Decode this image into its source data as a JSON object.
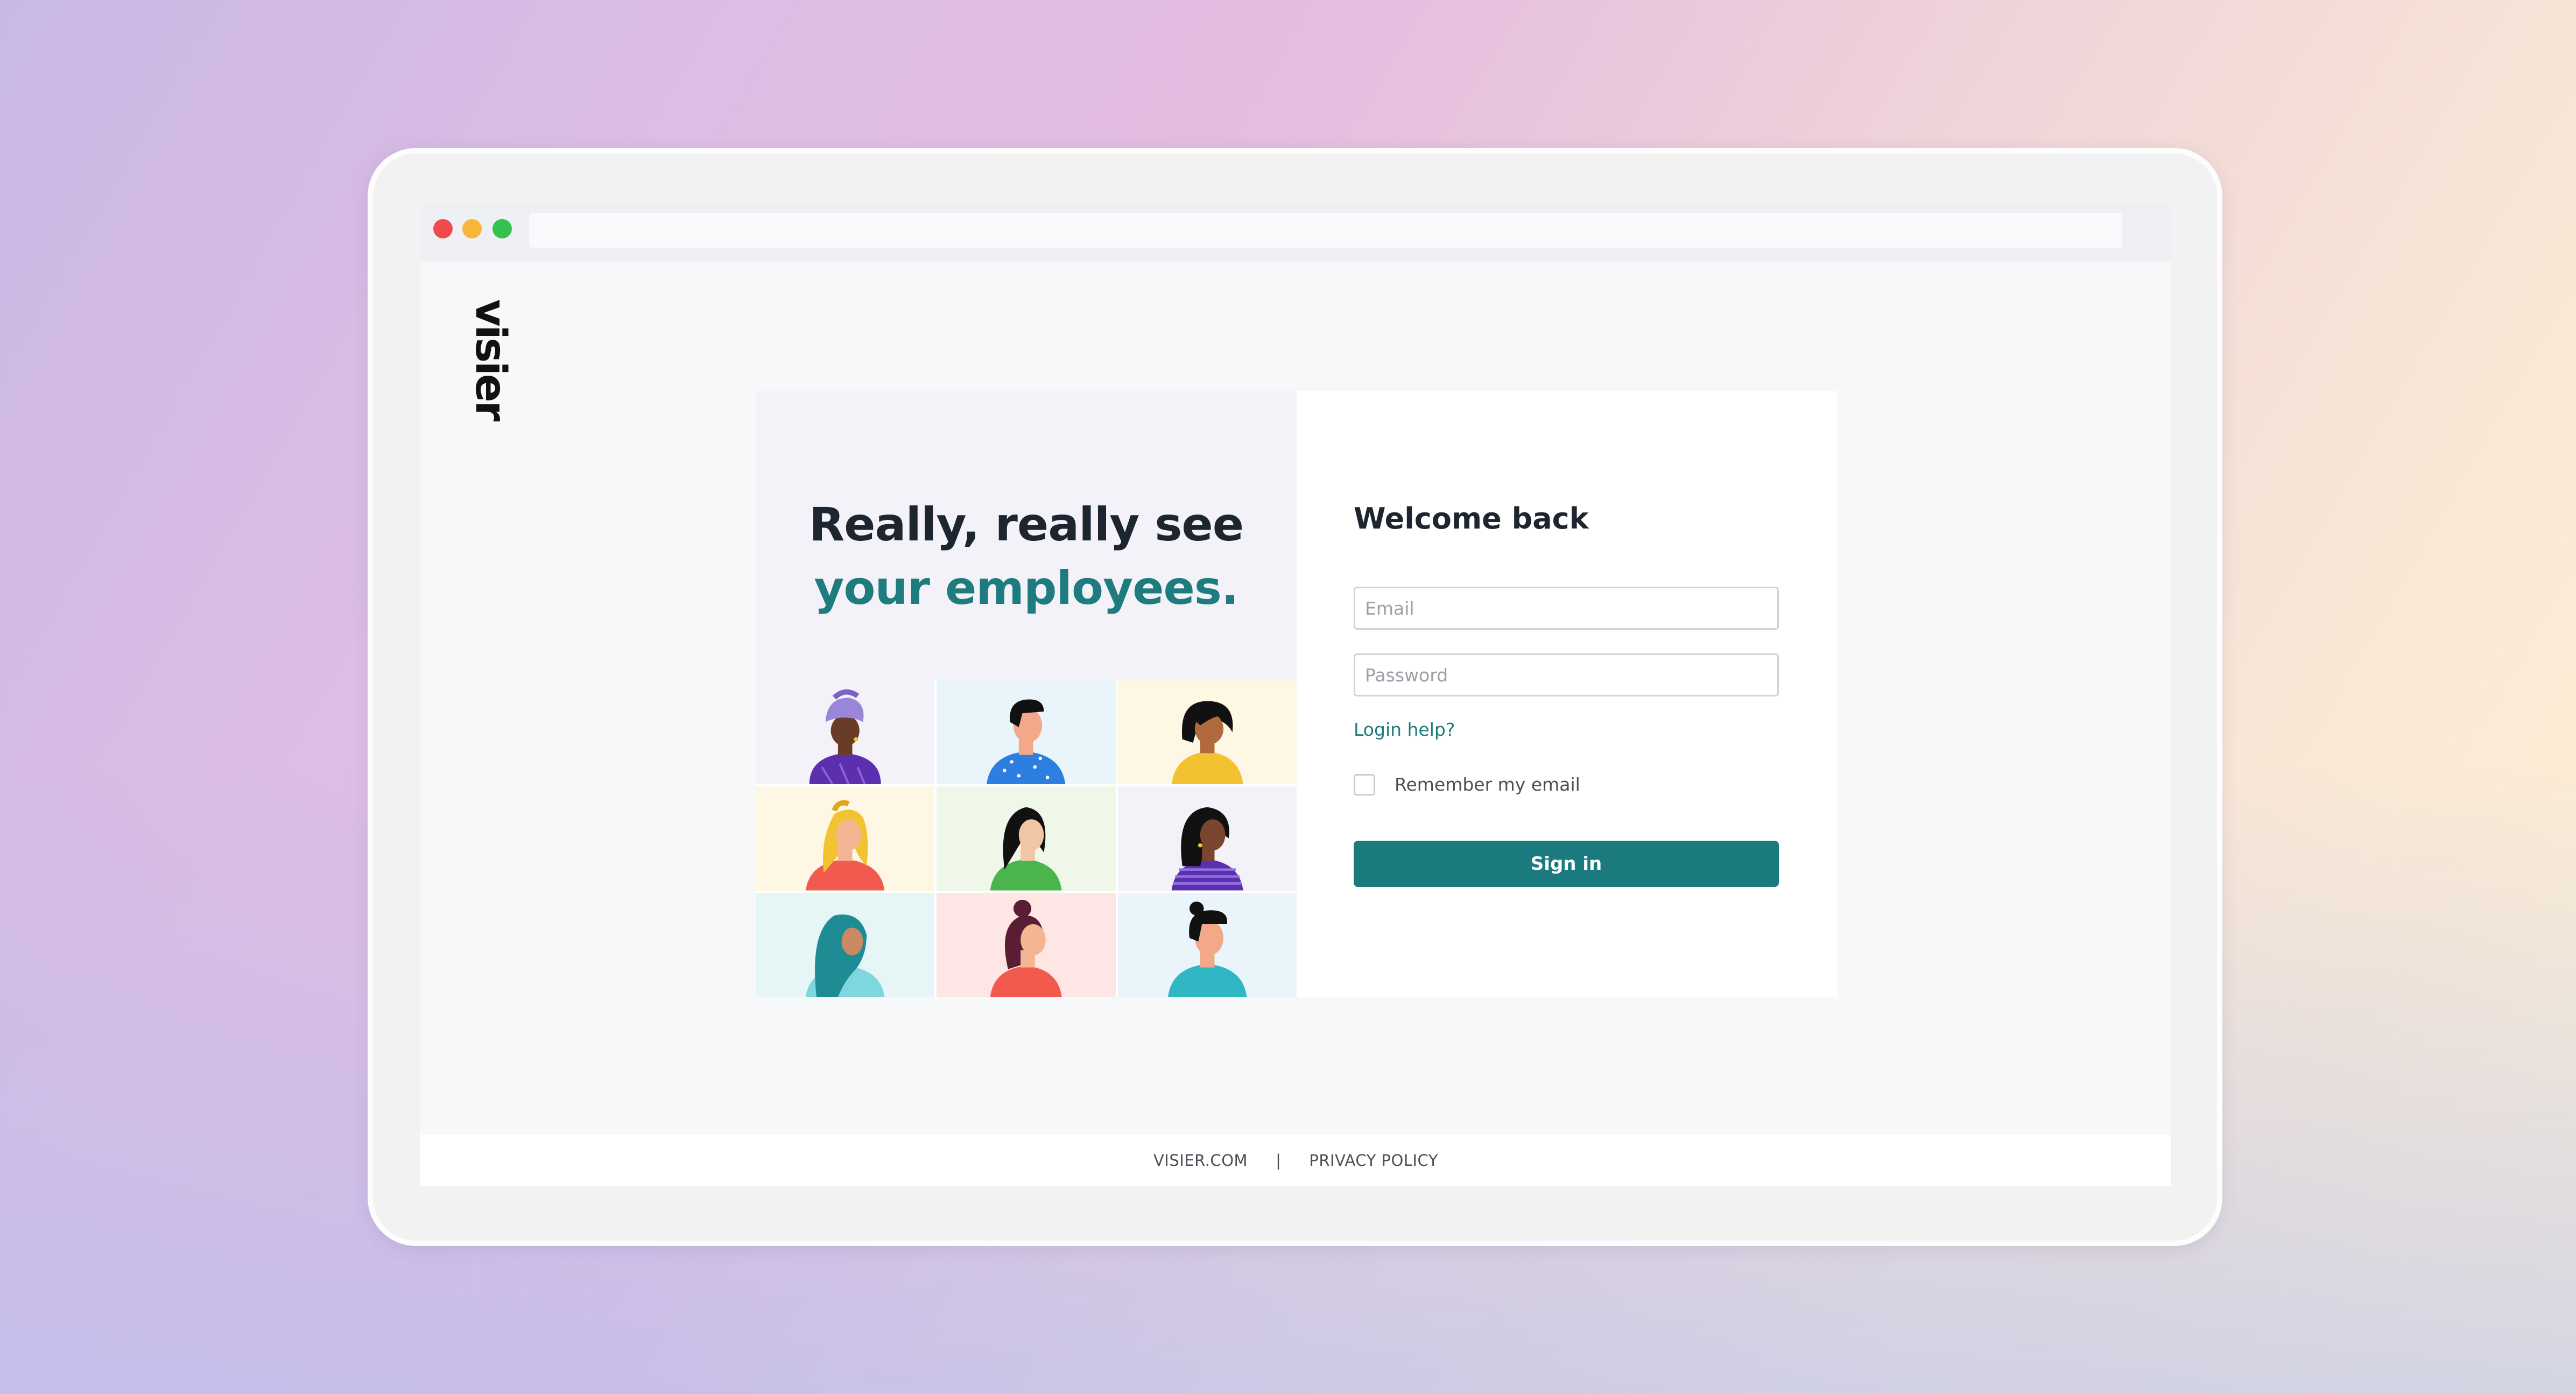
{
  "window": {
    "controls": [
      {
        "name": "close",
        "color": "#ef4b4a"
      },
      {
        "name": "minimize",
        "color": "#f6b739"
      },
      {
        "name": "maximize",
        "color": "#33c24d"
      }
    ],
    "address": ""
  },
  "brand": {
    "logo_text": "visier"
  },
  "hero": {
    "headline_line1": "Really, really see",
    "headline_line2": "your employees.",
    "accent_color": "#1e7b7e",
    "illustrations": [
      "person-purple-headwrap-icon",
      "person-blue-shirt-icon",
      "person-yellow-top-icon",
      "person-blonde-red-top-icon",
      "person-green-top-icon",
      "person-purple-striped-icon",
      "person-teal-hijab-icon",
      "person-red-top-bun-icon",
      "person-teal-shirt-icon"
    ]
  },
  "login": {
    "title": "Welcome back",
    "email_placeholder": "Email",
    "email_value": "",
    "password_placeholder": "Password",
    "password_value": "",
    "login_help": "Login help?",
    "remember_label": "Remember my email",
    "remember_checked": false,
    "sign_in": "Sign in",
    "button_color": "#1b7a7d"
  },
  "footer": {
    "site_link": "VISIER.COM",
    "separator": "|",
    "privacy_link": "PRIVACY POLICY"
  }
}
